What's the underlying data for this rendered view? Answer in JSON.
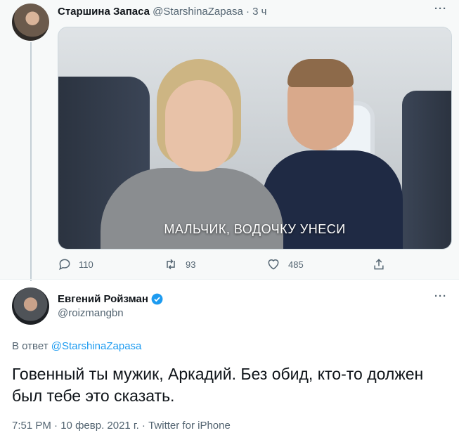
{
  "parent_tweet": {
    "name": "Старшина Запаса",
    "handle": "@StarshinaZapasa",
    "separator": "·",
    "time": "3 ч",
    "media_caption": "МАЛЬЧИК, ВОДОЧКУ УНЕСИ",
    "replies": "110",
    "retweets": "93",
    "likes": "485"
  },
  "main_tweet": {
    "name": "Евгений Ройзман",
    "handle": "@roizmangbn",
    "reply_prefix": "В ответ",
    "reply_to": "@StarshinaZapasa",
    "text": "Говенный ты мужик, Аркадий. Без обид, кто-то должен был тебе это сказать.",
    "time": "7:51 PM",
    "date": "10 февр. 2021 г.",
    "source": "Twitter for iPhone",
    "meta_separator": " · "
  },
  "colors": {
    "link": "#1d9bf0",
    "muted": "#536471",
    "verified": "#1d9bf0"
  },
  "icons": [
    "more-icon",
    "reply-icon",
    "retweet-icon",
    "like-icon",
    "share-icon",
    "verified-badge-icon"
  ]
}
